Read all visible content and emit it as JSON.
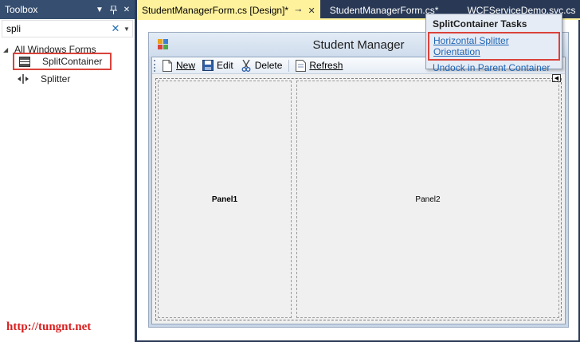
{
  "toolbox": {
    "title": "Toolbox",
    "search_value": "spli",
    "group_label": "All Windows Forms",
    "items": [
      {
        "label": "SplitContainer",
        "icon": "split-container-icon"
      },
      {
        "label": "Splitter",
        "icon": "splitter-icon"
      }
    ]
  },
  "watermark": "http://tungnt.net",
  "tabs": [
    {
      "label": "StudentManagerForm.cs [Design]*",
      "active": true
    },
    {
      "label": "StudentManagerForm.cs*",
      "active": false
    },
    {
      "label": "WCFServiceDemo.svc.cs",
      "active": false
    }
  ],
  "form": {
    "title": "Student Manager",
    "toolbar": {
      "new_label": "New",
      "edit_label": "Edit",
      "delete_label": "Delete",
      "refresh_label": "Refresh"
    },
    "panel1_label": "Panel1",
    "panel2_label": "Panel2"
  },
  "smart_tag": {
    "header": "SplitContainer Tasks",
    "links": [
      "Horizontal Splitter Orientation",
      "Undock in Parent Container"
    ]
  },
  "colors": {
    "ide_background": "#293955",
    "active_tab": "#fff29d",
    "highlight_border": "#d9433b",
    "link": "#1e64b4"
  }
}
